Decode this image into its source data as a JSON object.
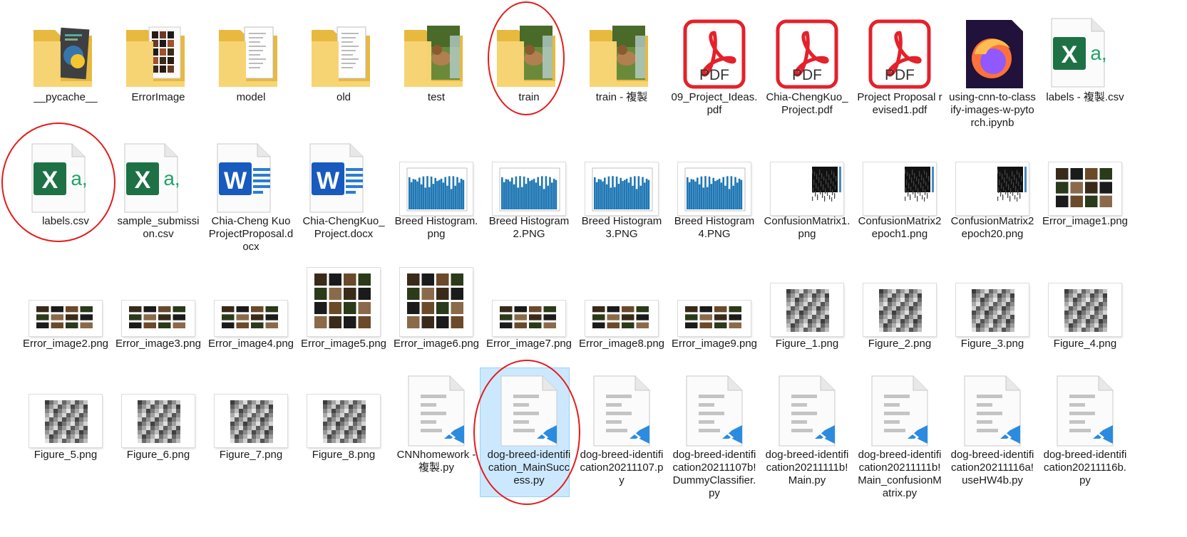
{
  "files": [
    {
      "name": "__pycache__",
      "type": "folder",
      "preview": "python"
    },
    {
      "name": "ErrorImage",
      "type": "folder",
      "preview": "photos"
    },
    {
      "name": "model",
      "type": "folder",
      "preview": "docs"
    },
    {
      "name": "old",
      "type": "folder",
      "preview": "docs"
    },
    {
      "name": "test",
      "type": "folder",
      "preview": "dogs"
    },
    {
      "name": "train",
      "type": "folder",
      "preview": "dogs",
      "highlighted": true
    },
    {
      "name": "train - 複製",
      "type": "folder",
      "preview": "dogs"
    },
    {
      "name": "09_Project_Ideas.pdf",
      "type": "pdf",
      "icon_text": "PDF"
    },
    {
      "name": "Chia-ChengKuo_Project.pdf",
      "type": "pdf",
      "icon_text": "PDF"
    },
    {
      "name": "Project Proposal revised1.pdf",
      "type": "pdf",
      "icon_text": "PDF"
    },
    {
      "name": "using-cnn-to-classify-images-w-pytorch.ipynb",
      "type": "ipynb"
    },
    {
      "name": "labels - 複製.csv",
      "type": "csv",
      "icon_text": "X",
      "icon_sub": "a,"
    },
    {
      "name": "labels.csv",
      "type": "csv",
      "icon_text": "X",
      "icon_sub": "a,",
      "highlighted": true
    },
    {
      "name": "sample_submission.csv",
      "type": "csv",
      "icon_text": "X",
      "icon_sub": "a,"
    },
    {
      "name": "Chia-Cheng Kuo ProjectProposal.docx",
      "type": "docx",
      "icon_text": "W"
    },
    {
      "name": "Chia-ChengKuo_Project.docx",
      "type": "docx",
      "icon_text": "W"
    },
    {
      "name": "Breed Histogram.png",
      "type": "image",
      "preview": "hist"
    },
    {
      "name": "Breed Histogram2.PNG",
      "type": "image",
      "preview": "hist"
    },
    {
      "name": "Breed Histogram3.PNG",
      "type": "image",
      "preview": "hist"
    },
    {
      "name": "Breed Histogram4.PNG",
      "type": "image",
      "preview": "hist"
    },
    {
      "name": "ConfusionMatrix1.png",
      "type": "image",
      "preview": "cm"
    },
    {
      "name": "ConfusionMatrix2 epoch1.png",
      "type": "image",
      "preview": "cm"
    },
    {
      "name": "ConfusionMatrix2 epoch20.png",
      "type": "image",
      "preview": "cm"
    },
    {
      "name": "Error_image1.png",
      "type": "image",
      "preview": "grid"
    },
    {
      "name": "Error_image2.png",
      "type": "image",
      "preview": "grid"
    },
    {
      "name": "Error_image3.png",
      "type": "image",
      "preview": "grid"
    },
    {
      "name": "Error_image4.png",
      "type": "image",
      "preview": "grid"
    },
    {
      "name": "Error_image5.png",
      "type": "image",
      "preview": "grid"
    },
    {
      "name": "Error_image6.png",
      "type": "image",
      "preview": "grid"
    },
    {
      "name": "Error_image7.png",
      "type": "image",
      "preview": "grid"
    },
    {
      "name": "Error_image8.png",
      "type": "image",
      "preview": "grid"
    },
    {
      "name": "Error_image9.png",
      "type": "image",
      "preview": "grid"
    },
    {
      "name": "Figure_1.png",
      "type": "image",
      "preview": "gray"
    },
    {
      "name": "Figure_2.png",
      "type": "image",
      "preview": "gray"
    },
    {
      "name": "Figure_3.png",
      "type": "image",
      "preview": "gray"
    },
    {
      "name": "Figure_4.png",
      "type": "image",
      "preview": "gray"
    },
    {
      "name": "Figure_5.png",
      "type": "image",
      "preview": "gray"
    },
    {
      "name": "Figure_6.png",
      "type": "image",
      "preview": "gray"
    },
    {
      "name": "Figure_7.png",
      "type": "image",
      "preview": "gray"
    },
    {
      "name": "Figure_8.png",
      "type": "image",
      "preview": "gray"
    },
    {
      "name": "CNNhomework - 複製.py",
      "type": "py"
    },
    {
      "name": "dog-breed-identification_MainSuccess.py",
      "type": "py",
      "selected": true,
      "highlighted": true
    },
    {
      "name": "dog-breed-identification20211107.py",
      "type": "py"
    },
    {
      "name": "dog-breed-identification20211107b!DummyClassifier.py",
      "type": "py"
    },
    {
      "name": "dog-breed-identification20211111b!Main.py",
      "type": "py"
    },
    {
      "name": "dog-breed-identification20211111b!Main_confusionMatrix.py",
      "type": "py"
    },
    {
      "name": "dog-breed-identification20211116a!useHW4b.py",
      "type": "py"
    },
    {
      "name": "dog-breed-identification20211116b.py",
      "type": "py"
    }
  ],
  "colors": {
    "folder": "#f7d474",
    "folder_dark": "#e8b93f",
    "pdf": "#e4212a",
    "excel": "#1e7145",
    "word": "#185abd",
    "vscode": "#2a8be0",
    "selection": "#cce8ff",
    "annotation": "#e41b1b"
  }
}
